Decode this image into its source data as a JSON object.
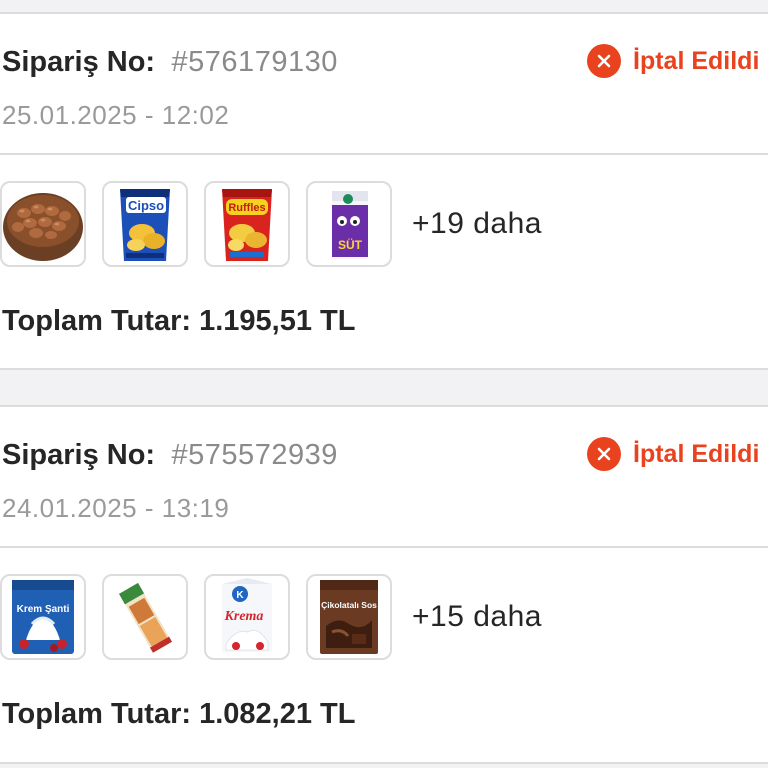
{
  "orders": [
    {
      "order_label": "Sipariş No:",
      "order_number": "#576179130",
      "date": "25.01.2025 - 12:02",
      "status": "İptal Edildi",
      "products": [
        {
          "name": "roasted peanuts",
          "icon": "peanut-bowl"
        },
        {
          "name": "Cipso",
          "icon": "chips-bag-blue"
        },
        {
          "name": "Ruffles",
          "icon": "chips-bag-red"
        },
        {
          "name": "SÜT",
          "icon": "milk-carton-purple"
        }
      ],
      "more_count": "+19 daha",
      "total": "Toplam Tutar: 1.195,51 TL"
    },
    {
      "order_label": "Sipariş No:",
      "order_number": "#575572939",
      "date": "24.01.2025 - 13:19",
      "status": "İptal Edildi",
      "products": [
        {
          "name": "Krem Şanti",
          "icon": "whipped-cream-box"
        },
        {
          "name": "pastry",
          "icon": "pastry-pack"
        },
        {
          "name": "Krema",
          "icon": "cream-carton"
        },
        {
          "name": "Çikolatalı Sos",
          "icon": "chocolate-sauce-box"
        }
      ],
      "more_count": "+15 daha",
      "total": "Toplam Tutar: 1.082,21 TL"
    }
  ],
  "colors": {
    "status_red": "#e8431e",
    "text_dark": "#262626",
    "text_muted": "#8a8a8a",
    "divider": "#dcdcdc",
    "background": "#f2f2f4"
  }
}
